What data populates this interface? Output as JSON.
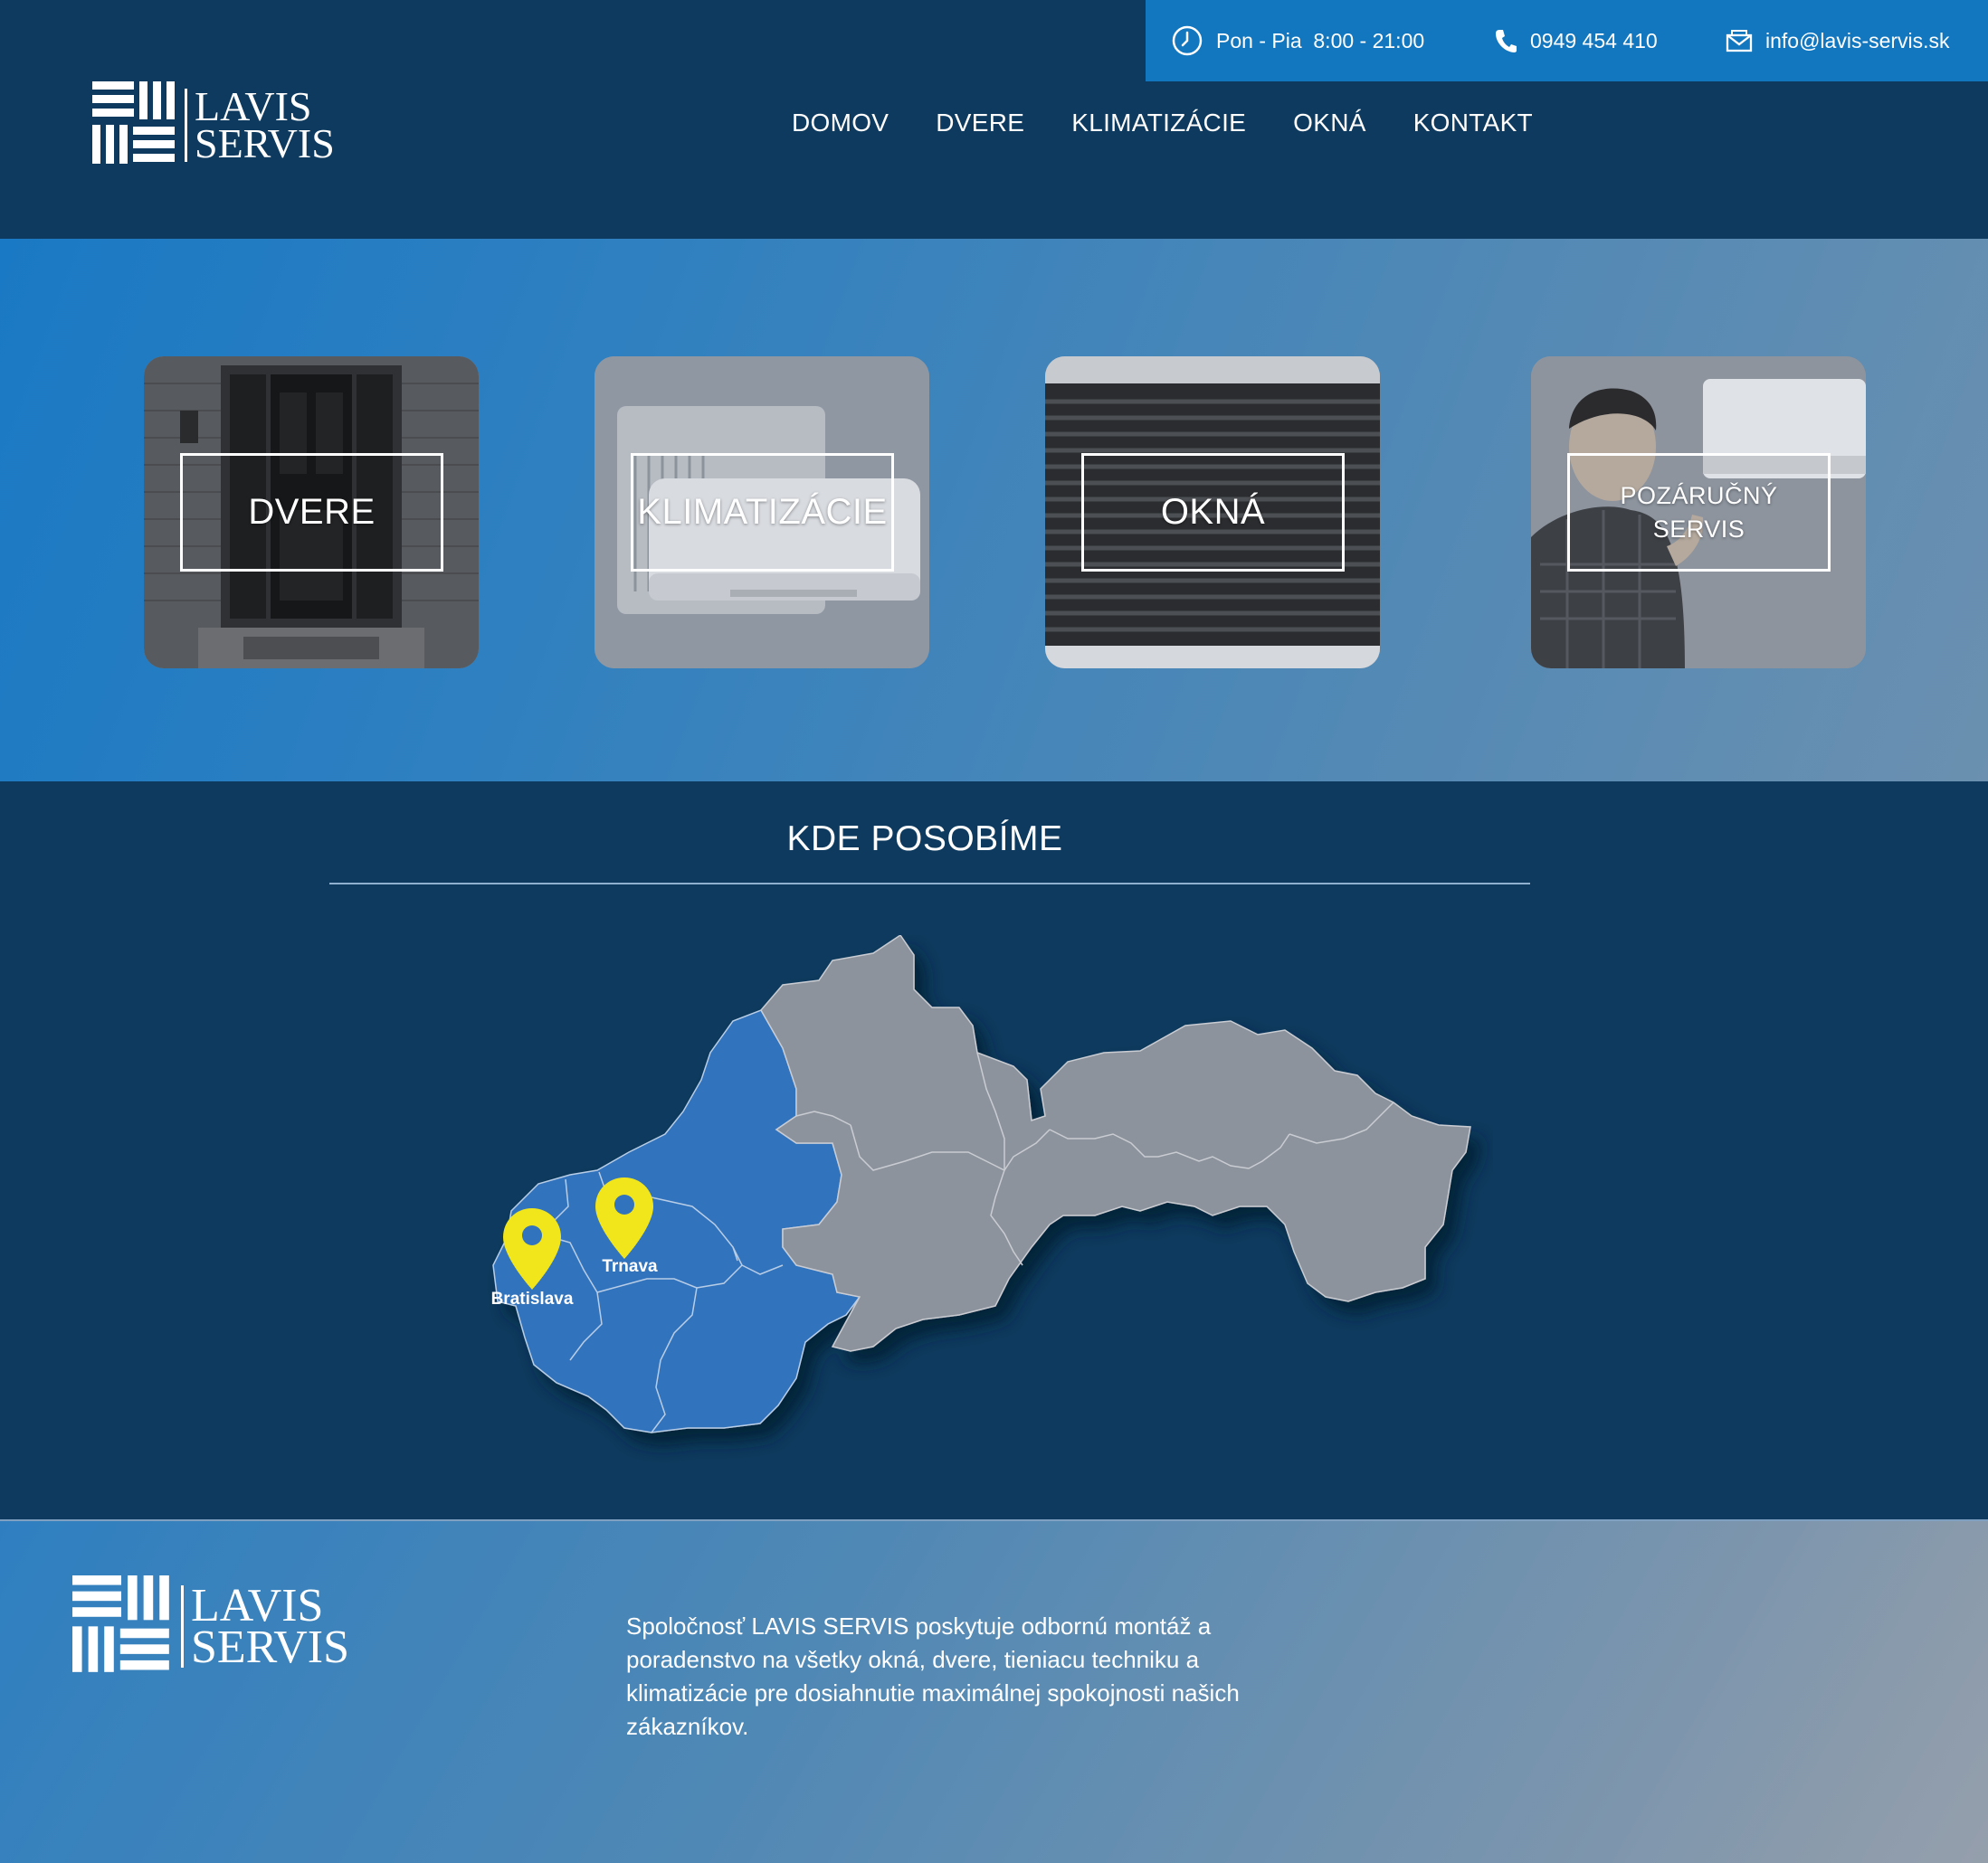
{
  "topbar": {
    "hours": "Pon - Pia  8:00 - 21:00",
    "phone": "0949 454 410",
    "email": "info@lavis-servis.sk"
  },
  "brand": {
    "line1": "LAVIS",
    "line2": "SERVIS"
  },
  "nav": {
    "items": [
      "DOMOV",
      "DVERE",
      "KLIMATIZÁCIE",
      "OKNÁ",
      "KONTAKT"
    ]
  },
  "services": [
    {
      "title": "DVERE"
    },
    {
      "title": "KLIMATIZÁCIE"
    },
    {
      "title": "OKNÁ"
    },
    {
      "title": "POZÁRUČNÝ SERVIS"
    }
  ],
  "coverage": {
    "title": "KDE POSOBÍME",
    "cities": [
      "Bratislava",
      "Trnava"
    ]
  },
  "footer": {
    "about": "Spoločnosť LAVIS SERVIS poskytuje odbornú montáž a poradenstvo na všetky okná, dvere, tieniacu techniku a klimatizácie pre dosiahnutie maximálnej spokojnosti našich zákazníkov."
  },
  "colors": {
    "navy": "#0d3a5e",
    "topbar": "#1277bf",
    "region_active": "#3273bd",
    "region_inactive": "#8d939c",
    "pin": "#f1e51b"
  }
}
